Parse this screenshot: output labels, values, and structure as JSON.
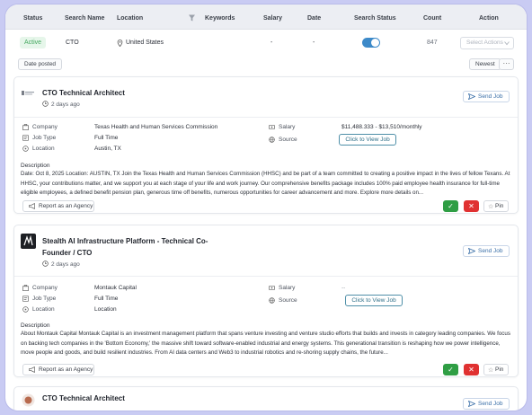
{
  "table": {
    "headers": {
      "status": "Status",
      "search_name": "Search Name",
      "location": "Location",
      "keywords": "Keywords",
      "salary": "Salary",
      "date": "Date",
      "search_status": "Search Status",
      "count": "Count",
      "action": "Action"
    },
    "row": {
      "status": "Active",
      "search_name": "CTO",
      "location": "United States",
      "keywords": "",
      "salary": "-",
      "date": "-",
      "search_status_on": true,
      "count": "847",
      "action_placeholder": "Select Actions"
    }
  },
  "toolbar": {
    "sort_date_label": "Date posted",
    "newest_label": "Newest",
    "more_label": "···"
  },
  "labels": {
    "company": "Company",
    "job_type": "Job Type",
    "location": "Location",
    "salary": "Salary",
    "source": "Source",
    "description": "Description",
    "send_job": "Send Job",
    "view_job": "Click to View Job",
    "report": "Report as an Agency",
    "pin": "Pin",
    "approve": "✓",
    "reject": "✕"
  },
  "jobs": [
    {
      "title": "CTO Technical Architect",
      "posted": "2 days ago",
      "company": "Texas Health and Human Services Commission",
      "job_type": "Full Time",
      "location": "Austin, TX",
      "salary": "$11,488.333 - $13,510/monthly",
      "source": "",
      "description": "Date: Oct 8, 2025 Location: AUSTIN, TX Join the Texas Health and Human Services Commission (HHSC) and be part of a team committed to creating a positive impact in the lives of fellow Texans. At HHSC, your contributions matter, and we support you at each stage of your life and work journey. Our comprehensive benefits package includes 100% paid employee health insurance for full-time eligible employees, a defined benefit pension plan, generous time off benefits, numerous opportunities for career advancement and more. Explore more details on..."
    },
    {
      "title_line1": "Stealth AI Infrastructure Platform - Technical Co-",
      "title_line2": "Founder / CTO",
      "posted": "2 days ago",
      "company": "Montauk Capital",
      "job_type": "Full Time",
      "location": "Location",
      "salary": "--",
      "source": "",
      "description": "About Montauk Capital Montauk Capital is an investment management platform that spans venture investing and venture studio efforts that builds and invests in category leading companies. We focus on backing tech companies in the 'Bottom Economy,' the massive shift toward software-enabled industrial and energy systems. This generational transition is reshaping how we power intelligence, move people and goods, and build resilient industries. From AI data centers and Web3 to industrial robotics and re-shoring supply chains, the future..."
    },
    {
      "title": "CTO Technical Architect"
    }
  ],
  "colors": {
    "background": "#c9cbf3",
    "active_badge": "#43a85f",
    "toggle": "#3d8ac9",
    "approve": "#2f9e44",
    "reject": "#e03131"
  }
}
